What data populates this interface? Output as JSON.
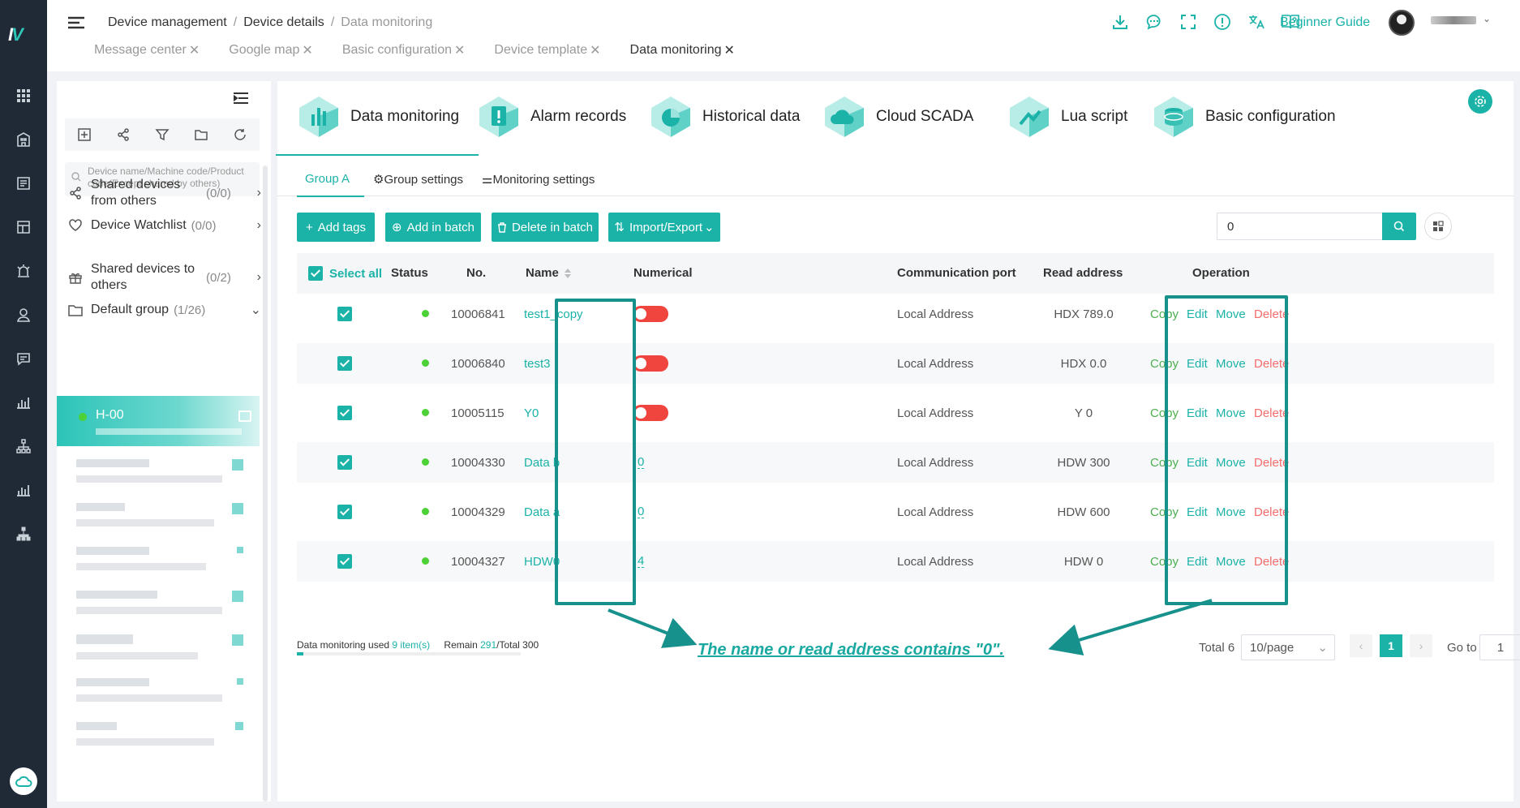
{
  "header": {
    "breadcrumb": [
      "Device management",
      "Device details",
      "Data monitoring"
    ],
    "tabs": [
      {
        "label": "Message center",
        "active": false
      },
      {
        "label": "Google map",
        "active": false
      },
      {
        "label": "Basic configuration",
        "active": false
      },
      {
        "label": "Device template",
        "active": false
      },
      {
        "label": "Data monitoring",
        "active": true
      }
    ],
    "close_glyph": "✕",
    "guide_label": "Beginner Guide",
    "icons": [
      "download-icon",
      "chat-icon",
      "fullscreen-icon",
      "alert-icon",
      "translate-icon",
      "help-book-icon"
    ]
  },
  "sidebar": {
    "search_placeholder": "Device name/Machine code/Product code(Except shared by others)",
    "groups": [
      {
        "label": "Shared devices from others",
        "count": "(0/0)",
        "icon": "share-icon"
      },
      {
        "label": "Device Watchlist",
        "count": "(0/0)",
        "icon": "heart-icon"
      },
      {
        "label": "Shared devices to others",
        "count": "(0/2)",
        "icon": "gift-icon"
      },
      {
        "label": "Default group",
        "count": "(1/26)",
        "icon": "folder-icon"
      }
    ],
    "active_device": "H-00"
  },
  "nav": {
    "items": [
      {
        "label": "Data monitoring",
        "active": true
      },
      {
        "label": "Alarm records",
        "active": false
      },
      {
        "label": "Historical data",
        "active": false
      },
      {
        "label": "Cloud SCADA",
        "active": false
      },
      {
        "label": "Lua script",
        "active": false
      },
      {
        "label": "Basic configuration",
        "active": false
      }
    ]
  },
  "subtabs": [
    "Group A",
    "Group settings",
    "Monitoring settings"
  ],
  "toolbar": {
    "add_tags": "Add tags",
    "add_batch": "Add in batch",
    "delete_batch": "Delete in batch",
    "import_export": "Import/Export",
    "search_value": "0"
  },
  "table": {
    "select_all": "Select all",
    "columns": [
      "Status",
      "No.",
      "Name",
      "Numerical",
      "Communication port",
      "Read address",
      "Operation"
    ],
    "rows": [
      {
        "no": "10006841",
        "name": "test1_copy",
        "numerical": "",
        "toggle": true,
        "port": "Local Address",
        "addr": "HDX 789.0"
      },
      {
        "no": "10006840",
        "name": "test3",
        "numerical": "",
        "toggle": true,
        "port": "Local Address",
        "addr": "HDX 0.0"
      },
      {
        "no": "10005115",
        "name": "Y0",
        "numerical": "",
        "toggle": true,
        "port": "Local Address",
        "addr": "Y 0"
      },
      {
        "no": "10004330",
        "name": "Data b",
        "numerical": "0",
        "toggle": false,
        "port": "Local Address",
        "addr": "HDW 300"
      },
      {
        "no": "10004329",
        "name": "Data a",
        "numerical": "0",
        "toggle": false,
        "port": "Local Address",
        "addr": "HDW 600"
      },
      {
        "no": "10004327",
        "name": "HDW0",
        "numerical": "4",
        "toggle": false,
        "port": "Local Address",
        "addr": "HDW 0"
      }
    ],
    "ops": {
      "copy": "Copy",
      "edit": "Edit",
      "move": "Move",
      "del": "Delete"
    }
  },
  "annotation": "The name or read address contains \"0\".",
  "footer": {
    "used_prefix": "Data monitoring used ",
    "used_count": "9 item(s)",
    "remain_prefix": "Remain ",
    "remain_count": "291",
    "total_suffix": "/Total 300",
    "usage_fraction": 0.03,
    "total_label": "Total 6",
    "page_size": "10/page",
    "current_page": "1",
    "goto_label": "Go to",
    "goto_value": "1"
  },
  "colors": {
    "accent": "#1bb2a8",
    "danger": "#f56c6c",
    "copy": "#4caf50",
    "highlight": "#17918c"
  }
}
